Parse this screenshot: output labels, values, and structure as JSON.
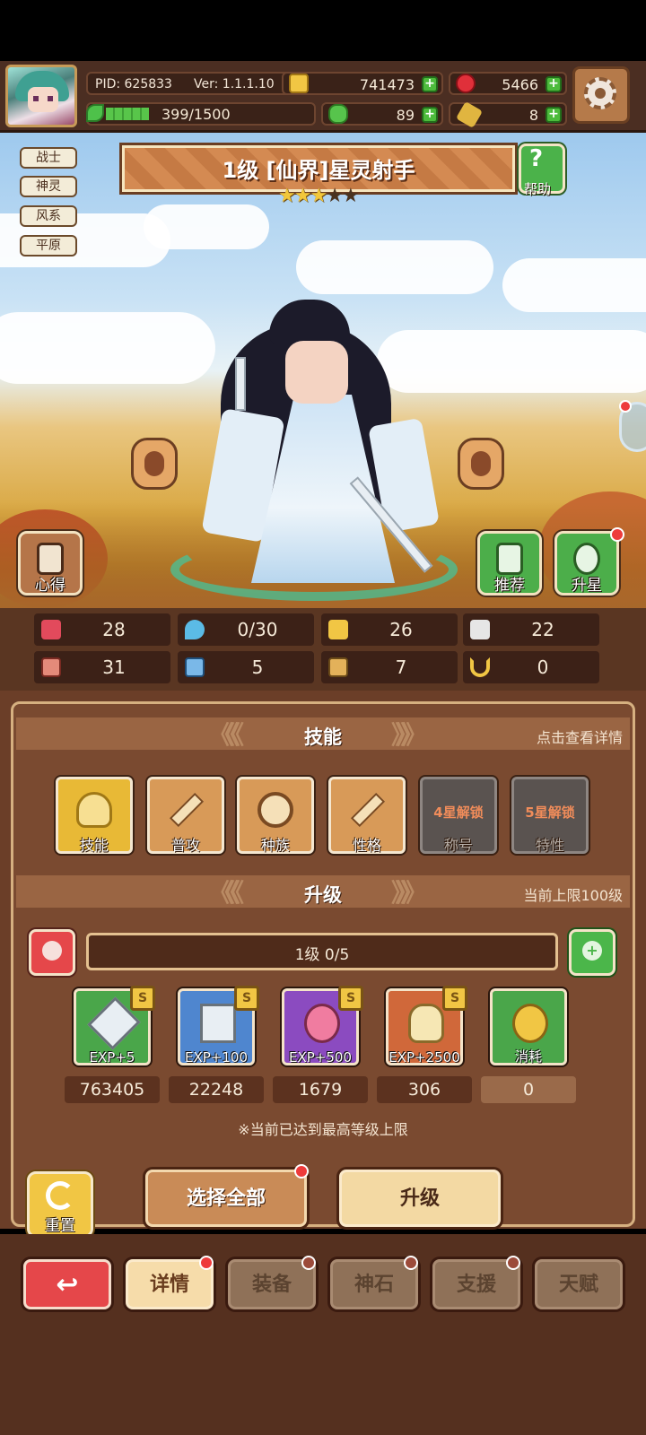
{
  "header": {
    "pid": "PID: 625833",
    "version": "Ver: 1.1.1.10",
    "exp": "399/1500",
    "exp_fraction": 0.266,
    "coins": "741473",
    "gems": "5466",
    "clovers": "89",
    "keys": "8"
  },
  "tags": [
    "战士",
    "神灵",
    "风系",
    "平原"
  ],
  "hero": {
    "title": "1级 [仙界]星灵射手",
    "stars_filled": 3,
    "stars_total": 5,
    "help_label": "帮助"
  },
  "side_buttons": {
    "notes": "心得",
    "recommend": "推荐",
    "star_up": "升星"
  },
  "stats": [
    "28",
    "0/30",
    "26",
    "22",
    "31",
    "5",
    "7",
    "0"
  ],
  "skills_section": {
    "title": "技能",
    "hint": "点击查看详情",
    "items": [
      {
        "label": "技能"
      },
      {
        "label": "普攻"
      },
      {
        "label": "种族"
      },
      {
        "label": "性格"
      },
      {
        "label": "称号",
        "lock": "4星解锁"
      },
      {
        "label": "特性",
        "lock": "5星解锁"
      }
    ]
  },
  "upgrade_section": {
    "title": "升级",
    "hint": "当前上限100级",
    "level_text": "1级  0/5",
    "items": [
      {
        "label": "EXP+5",
        "count": "763405",
        "color": "#4aa64a"
      },
      {
        "label": "EXP+100",
        "count": "22248",
        "color": "#4f86cf"
      },
      {
        "label": "EXP+500",
        "count": "1679",
        "color": "#8b4bc0"
      },
      {
        "label": "EXP+2500",
        "count": "306",
        "color": "#d0683a"
      },
      {
        "label": "消耗",
        "count": "0",
        "color": "#4aa64a"
      }
    ],
    "notice": "※当前已达到最高等级上限"
  },
  "actions": {
    "reset": "重置",
    "select_all": "选择全部",
    "upgrade": "升级"
  },
  "tabs": [
    "详情",
    "装备",
    "神石",
    "支援",
    "天赋"
  ]
}
